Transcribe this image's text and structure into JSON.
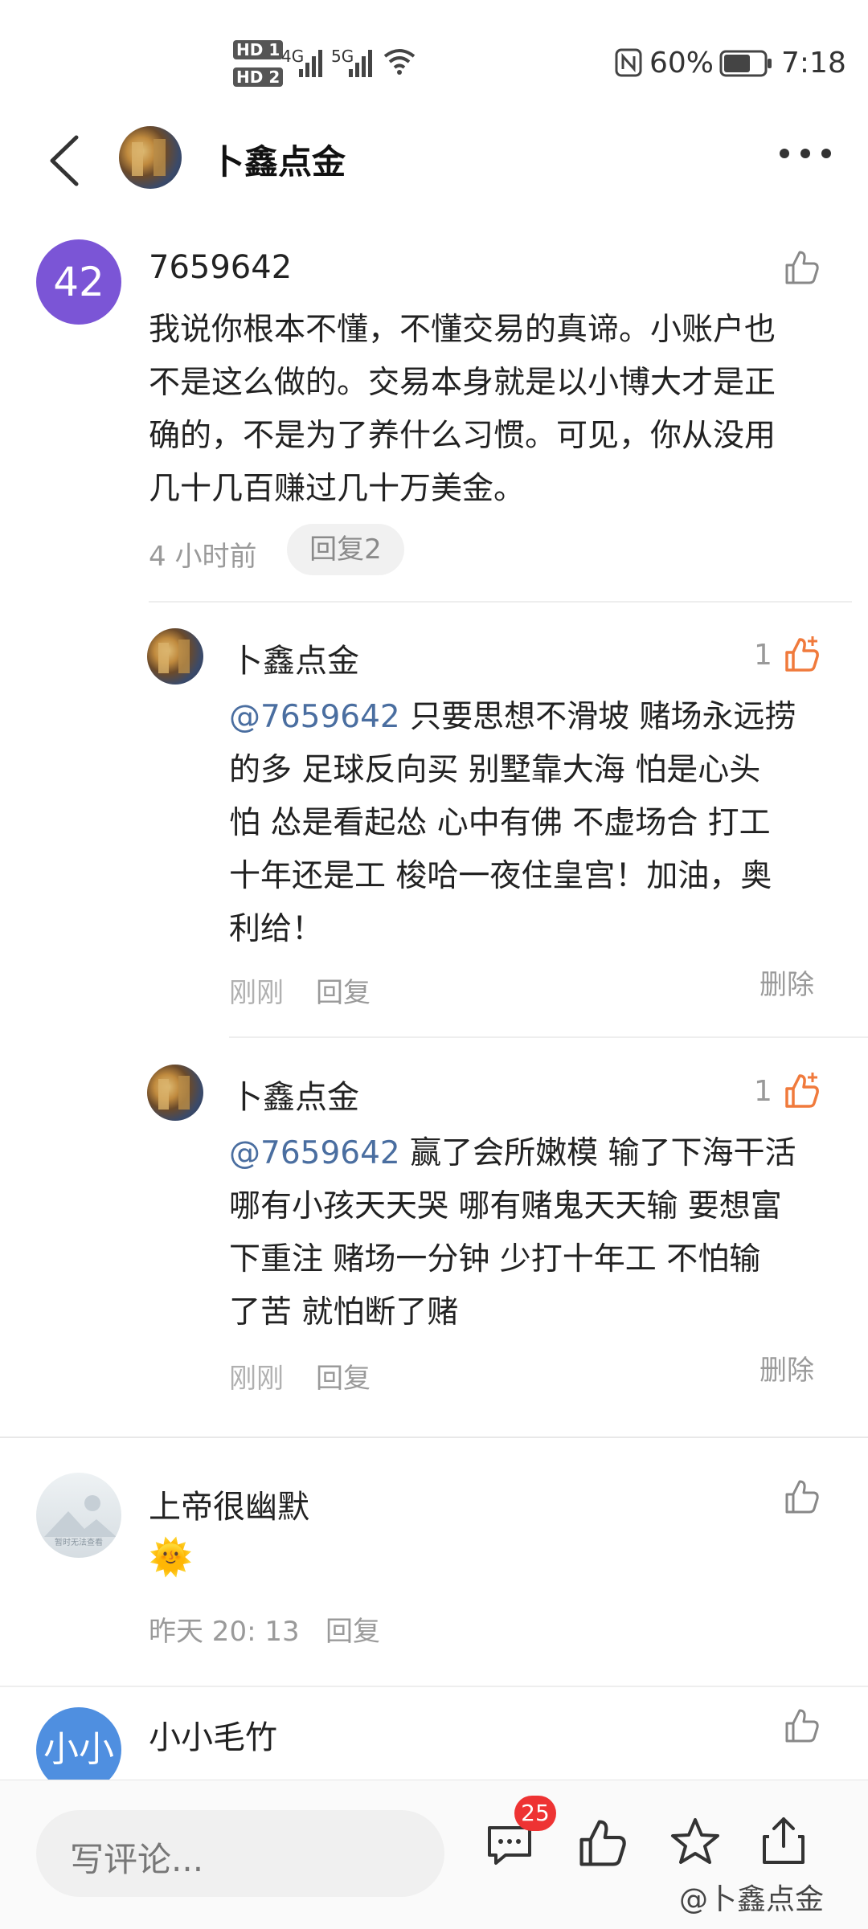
{
  "status_bar": {
    "hd1": "HD",
    "hd1_num": "1",
    "hd2": "HD",
    "hd2_num": "2",
    "net1": "4G",
    "net2": "5G",
    "battery": "60%",
    "time": "7:18"
  },
  "header": {
    "title": "卜鑫点金"
  },
  "comments": [
    {
      "avatar_text": "42",
      "avatar_color": "#7b55d6",
      "user": "7659642",
      "lines": [
        "我说你根本不懂，不懂交易的真谛。小账户也",
        "不是这么做的。交易本身就是以小博大才是正",
        "确的，不是为了养什么习惯。可见，你从没用",
        "几十几百赚过几十万美金。"
      ],
      "time": "4 小时前",
      "reply_label": "回复2",
      "replies": [
        {
          "user": "卜鑫点金",
          "like_count": "1",
          "mention": "@7659642",
          "first_line": " 只要思想不滑坡 赌场永远捞",
          "lines": [
            "的多 足球反向买 别墅靠大海 怕是心头",
            "怕 怂是看起怂 心中有佛 不虚场合 打工",
            "十年还是工 梭哈一夜住皇宫！加油，奥",
            "利给！"
          ],
          "time": "刚刚",
          "reply_label": "回复",
          "delete_label": "删除"
        },
        {
          "user": "卜鑫点金",
          "like_count": "1",
          "mention": "@7659642",
          "first_line": " 赢了会所嫩模 输了下海干活",
          "lines": [
            "哪有小孩天天哭 哪有赌鬼天天输 要想富",
            "下重注 赌场一分钟 少打十年工 不怕输",
            "了苦 就怕断了赌"
          ],
          "time": "刚刚",
          "reply_label": "回复",
          "delete_label": "删除"
        }
      ]
    },
    {
      "avatar_caption": "暂时无法查看",
      "user": "上帝很幽默",
      "emoji": "🌞",
      "time": "昨天 20: 13",
      "reply_label": "回复"
    },
    {
      "avatar_text": "小小",
      "avatar_color": "#4f8fe0",
      "user": "小小毛竹"
    }
  ],
  "bottom_bar": {
    "input_placeholder": "写评论...",
    "comment_badge": "25",
    "watermark": "@卜鑫点金"
  },
  "icons": {
    "back": "chevron-left-icon",
    "more": "more-icon",
    "like": "thumb-up-icon",
    "liked": "thumb-up-filled-icon",
    "comment": "comment-icon",
    "star": "star-icon",
    "share": "share-icon"
  },
  "colors": {
    "liked_orange": "#f07a3c",
    "mention_blue": "#4a6ea0",
    "badge_red": "#ee3333"
  }
}
